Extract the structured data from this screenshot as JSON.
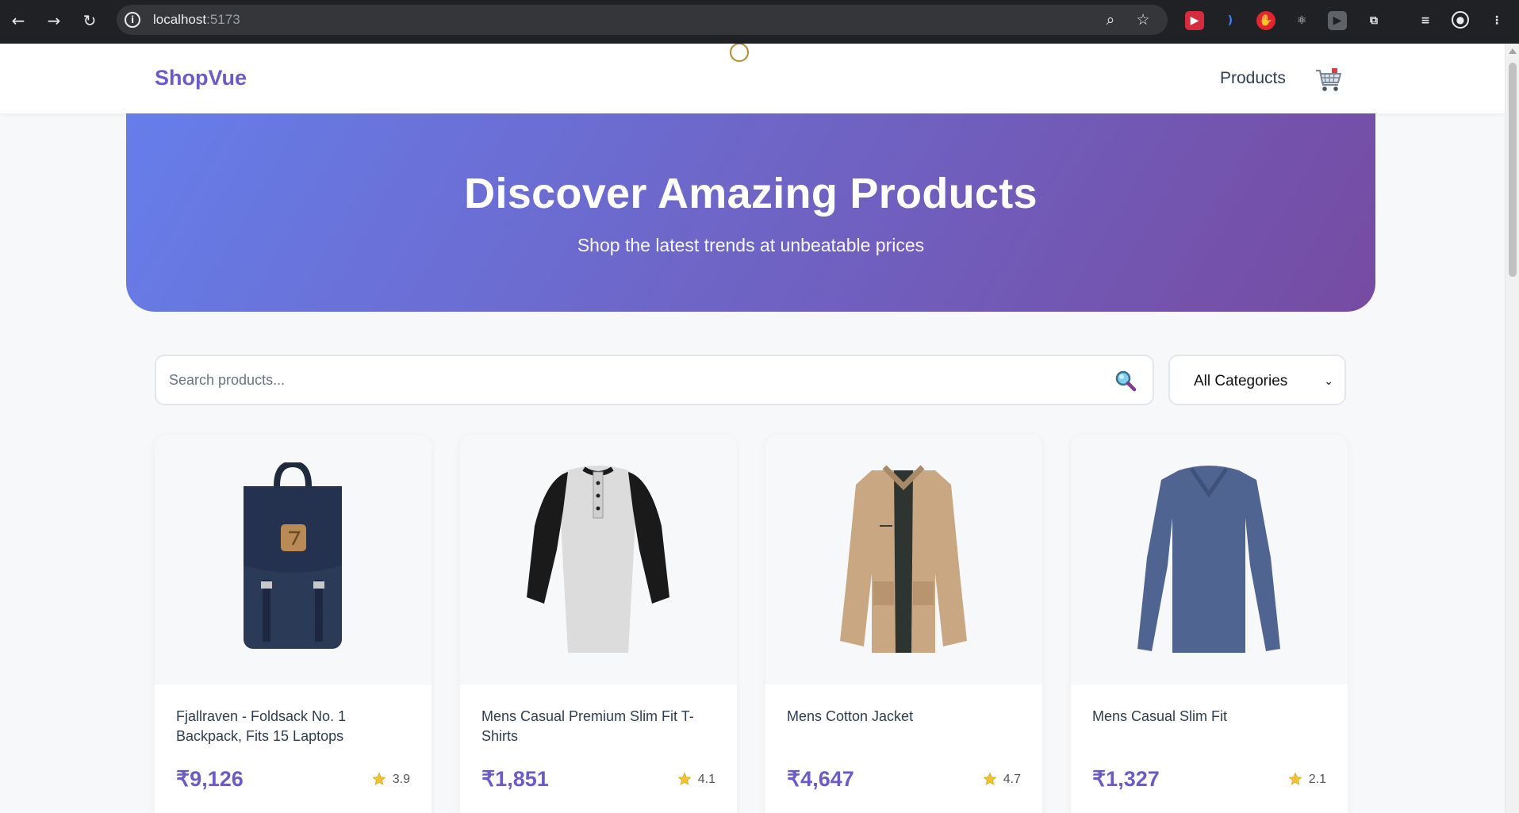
{
  "browser": {
    "url_host": "localhost",
    "url_port": ":5173"
  },
  "header": {
    "logo": "ShopVue",
    "nav_products": "Products"
  },
  "hero": {
    "title": "Discover Amazing Products",
    "subtitle": "Shop the latest trends at unbeatable prices"
  },
  "filters": {
    "search_placeholder": "Search products...",
    "category_selected": "All Categories"
  },
  "products": [
    {
      "title": "Fjallraven - Foldsack No. 1 Backpack, Fits 15 Laptops",
      "price": "₹9,126",
      "rating": "3.9"
    },
    {
      "title": "Mens Casual Premium Slim Fit T-Shirts",
      "price": "₹1,851",
      "rating": "4.1"
    },
    {
      "title": "Mens Cotton Jacket",
      "price": "₹4,647",
      "rating": "4.7"
    },
    {
      "title": "Mens Casual Slim Fit",
      "price": "₹1,327",
      "rating": "2.1"
    }
  ],
  "colors": {
    "accent": "#6a5bc9",
    "hero_start": "#667eea",
    "hero_end": "#764ba2",
    "star": "#f1c232"
  }
}
